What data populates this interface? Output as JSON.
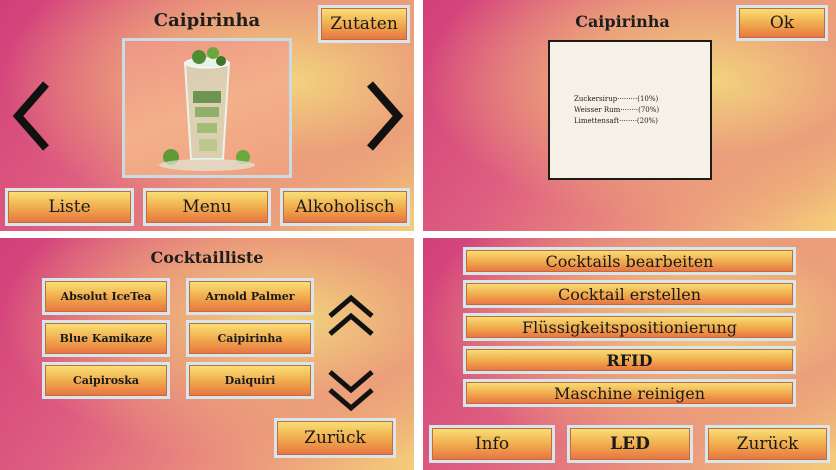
{
  "screen1": {
    "title": "Caipirinha",
    "ingredients_button": "Zutaten",
    "list_button": "Liste",
    "menu_button": "Menu",
    "alcoholic_button": "Alkoholisch",
    "image_icon": "cocktail-glass-image",
    "prev_icon": "chevron-left-icon",
    "next_icon": "chevron-right-icon"
  },
  "screen2": {
    "title": "Caipirinha",
    "ok_button": "Ok",
    "ingredients": [
      "Zuckersirup·········(10%)",
      "Weisser Rum········(70%)",
      "Limettensaft········(20%)"
    ]
  },
  "screen3": {
    "title": "Cocktailliste",
    "cocktails": [
      "Absolut IceTea",
      "Arnold Palmer",
      "Blue Kamikaze",
      "Caipirinha",
      "Caipiroska",
      "Daiquiri"
    ],
    "back_button": "Zurück",
    "up_icon": "double-chevron-up-icon",
    "down_icon": "double-chevron-down-icon"
  },
  "screen4": {
    "menu_items": [
      "Cocktails bearbeiten",
      "Cocktail erstellen",
      "Flüssigkeitspositionierung",
      "RFID",
      "Maschine reinigen"
    ],
    "info_button": "Info",
    "led_button": "LED",
    "back_button": "Zurück"
  },
  "colors": {
    "gradient_pink": "#d23f7a",
    "gradient_yellow": "#f4cd79",
    "button_top": "#f9e277",
    "button_bottom": "#e77242",
    "button_border": "#d7e6ec"
  }
}
